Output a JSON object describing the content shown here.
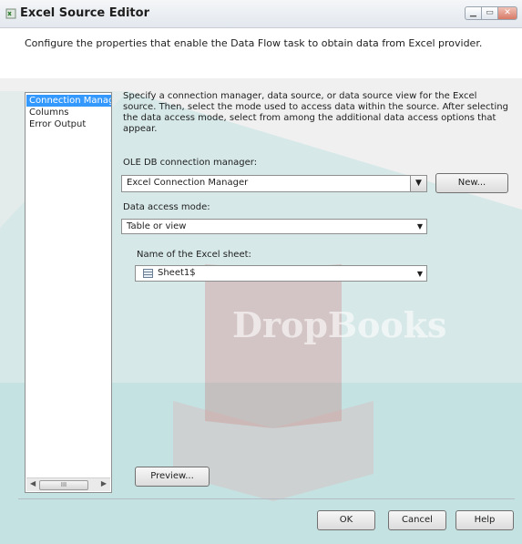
{
  "window": {
    "title": "Excel Source Editor",
    "description": "Configure the properties that enable the Data Flow task to obtain data from Excel provider."
  },
  "nav": {
    "items": [
      {
        "label": "Connection Manager",
        "selected": true
      },
      {
        "label": "Columns",
        "selected": false
      },
      {
        "label": "Error Output",
        "selected": false
      }
    ]
  },
  "main": {
    "instructions": "Specify a connection manager, data source, or data source view for the Excel source. Then, select the mode used to access data within the source. After selecting the data access mode, select from among the additional data access options that appear.",
    "connection_label": "OLE DB connection manager:",
    "connection_value": "Excel Connection Manager",
    "new_button": "New...",
    "access_mode_label": "Data access mode:",
    "access_mode_value": "Table or view",
    "sheet_label": "Name of the Excel sheet:",
    "sheet_value": "Sheet1$",
    "preview_button": "Preview..."
  },
  "footer": {
    "ok": "OK",
    "cancel": "Cancel",
    "help": "Help"
  },
  "watermark": {
    "text": "DropBooks"
  },
  "colors": {
    "watermark_teal": "#2bb3b1",
    "watermark_red": "#c94a4a",
    "selection": "#3399ff"
  }
}
